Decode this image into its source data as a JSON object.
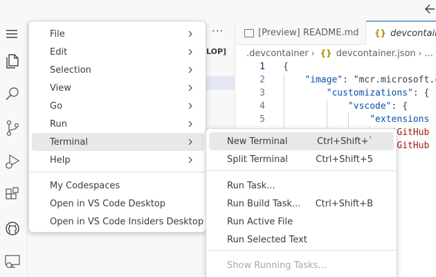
{
  "window": {
    "back_icon": "arrow-left-icon"
  },
  "activity_bar": {
    "items": [
      {
        "icon": "menu-icon"
      },
      {
        "icon": "files-icon"
      },
      {
        "icon": "search-icon"
      },
      {
        "icon": "source-control-icon"
      },
      {
        "icon": "run-debug-icon"
      },
      {
        "icon": "extensions-icon"
      },
      {
        "icon": "github-icon"
      },
      {
        "icon": "remote-explorer-icon"
      }
    ]
  },
  "sidebar": {
    "more_label": "···",
    "section_label": "LOP]"
  },
  "tabs": [
    {
      "label": "[Preview] README.md",
      "icon": "preview-icon"
    },
    {
      "label": "devcontainer.json",
      "icon": "json-braces-icon"
    }
  ],
  "breadcrumb": {
    "folder": ".devcontainer",
    "file": "devcontainer.json",
    "ellipsis": "..."
  },
  "editor": {
    "lines": [
      {
        "num": "1",
        "pre": "",
        "key": "",
        "rest": "{"
      },
      {
        "num": "2",
        "pre": "    ",
        "key": "\"image\"",
        "rest": ": \"mcr.microsoft.c"
      },
      {
        "num": "3",
        "pre": "        ",
        "key": "\"customizations\"",
        "rest": ": {"
      },
      {
        "num": "4",
        "pre": "            ",
        "key": "\"vscode\"",
        "rest": ": {"
      },
      {
        "num": "5",
        "pre": "                ",
        "key": "\"extensions",
        "rest": ""
      },
      {
        "num": "",
        "pre": "                    ",
        "key": "",
        "rest": "\"GitHub"
      },
      {
        "num": "",
        "pre": "                    ",
        "key": "",
        "rest": "\"GitHub"
      }
    ]
  },
  "main_menu": {
    "items": [
      {
        "label": "File",
        "submenu": true
      },
      {
        "label": "Edit",
        "submenu": true
      },
      {
        "label": "Selection",
        "submenu": true
      },
      {
        "label": "View",
        "submenu": true
      },
      {
        "label": "Go",
        "submenu": true
      },
      {
        "label": "Run",
        "submenu": true
      },
      {
        "label": "Terminal",
        "submenu": true
      },
      {
        "label": "Help",
        "submenu": true
      },
      {
        "label": "My Codespaces",
        "submenu": false
      },
      {
        "label": "Open in VS Code Desktop",
        "submenu": false
      },
      {
        "label": "Open in VS Code Insiders Desktop",
        "submenu": false
      }
    ]
  },
  "terminal_menu": {
    "items": [
      {
        "label": "New Terminal",
        "shortcut": "Ctrl+Shift+`"
      },
      {
        "label": "Split Terminal",
        "shortcut": "Ctrl+Shift+5"
      },
      {
        "label": "Run Task...",
        "shortcut": ""
      },
      {
        "label": "Run Build Task...",
        "shortcut": "Ctrl+Shift+B"
      },
      {
        "label": "Run Active File",
        "shortcut": ""
      },
      {
        "label": "Run Selected Text",
        "shortcut": ""
      },
      {
        "label": "Show Running Tasks...",
        "shortcut": ""
      }
    ]
  },
  "colors": {
    "accent": "#005fb8",
    "menu_highlight": "#e8e8e8",
    "json_key": "#0451a5",
    "json_string": "#a31515"
  }
}
